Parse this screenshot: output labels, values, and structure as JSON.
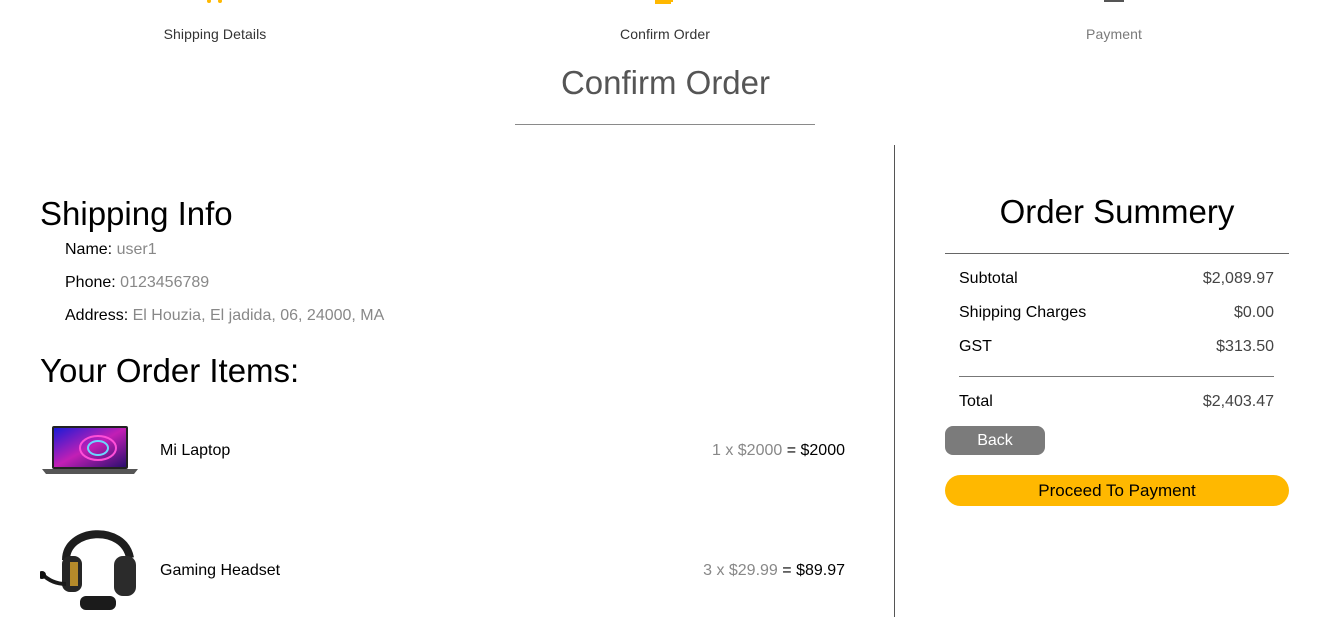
{
  "stepper": {
    "steps": [
      {
        "label": "Shipping Details",
        "icon": "truck-icon",
        "active": true
      },
      {
        "label": "Confirm Order",
        "icon": "library-books-icon",
        "active": true
      },
      {
        "label": "Payment",
        "icon": "bank-icon",
        "active": false
      }
    ],
    "active_color": "#ffb800",
    "inactive_color": "#555555"
  },
  "page_title": "Confirm Order",
  "shipping_info": {
    "heading": "Shipping Info",
    "name_label": "Name:",
    "name_value": "user1",
    "phone_label": "Phone:",
    "phone_value": "0123456789",
    "address_label": "Address:",
    "address_value": "El Houzia, El jadida, 06, 24000, MA"
  },
  "order_items": {
    "heading": "Your Order Items:",
    "items": [
      {
        "name": "Mi Laptop",
        "image": "laptop-image",
        "qty_price": "1 x $2000",
        "eq": " = ",
        "total": "$2000"
      },
      {
        "name": "Gaming Headset",
        "image": "headset-image",
        "qty_price": "3 x $29.99",
        "eq": " = ",
        "total": "$89.97"
      }
    ]
  },
  "order_summary": {
    "heading": "Order Summery",
    "rows": [
      {
        "label": "Subtotal",
        "value": "$2,089.97"
      },
      {
        "label": "Shipping Charges",
        "value": "$0.00"
      },
      {
        "label": "GST",
        "value": "$313.50"
      }
    ],
    "total_label": "Total",
    "total_value": "$2,403.47",
    "back_label": "Back",
    "proceed_label": "Proceed To Payment",
    "proceed_color": "#ffb800",
    "back_color": "#7b7b7b"
  }
}
